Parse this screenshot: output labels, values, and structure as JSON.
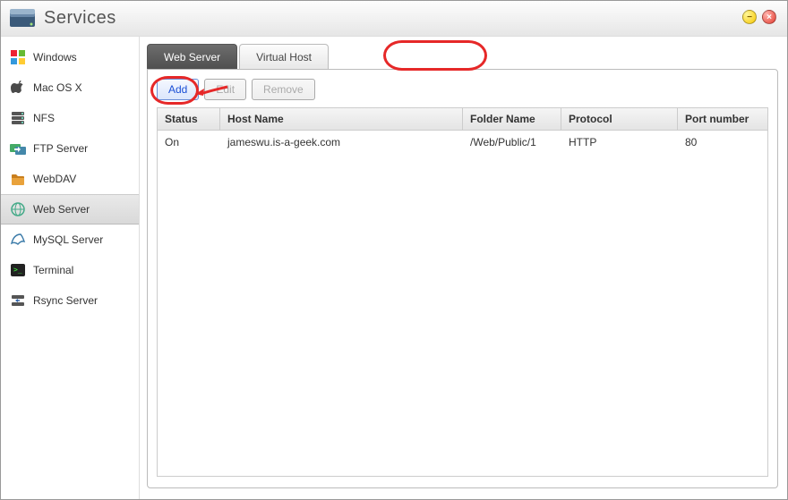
{
  "window": {
    "title": "Services"
  },
  "titlebar": {
    "minimize": "−",
    "close": "×"
  },
  "sidebar": {
    "items": [
      {
        "label": "Windows",
        "icon": "windows-icon"
      },
      {
        "label": "Mac OS X",
        "icon": "mac-icon"
      },
      {
        "label": "NFS",
        "icon": "nfs-icon"
      },
      {
        "label": "FTP Server",
        "icon": "ftp-icon"
      },
      {
        "label": "WebDAV",
        "icon": "webdav-icon"
      },
      {
        "label": "Web Server",
        "icon": "webserver-icon",
        "active": true
      },
      {
        "label": "MySQL Server",
        "icon": "mysql-icon"
      },
      {
        "label": "Terminal",
        "icon": "terminal-icon"
      },
      {
        "label": "Rsync Server",
        "icon": "rsync-icon"
      }
    ]
  },
  "tabs": [
    {
      "label": "Web Server",
      "active": true
    },
    {
      "label": "Virtual Host"
    }
  ],
  "toolbar": {
    "add_label": "Add",
    "edit_label": "Edit",
    "remove_label": "Remove"
  },
  "grid": {
    "headers": {
      "status": "Status",
      "host": "Host Name",
      "folder": "Folder Name",
      "protocol": "Protocol",
      "port": "Port number"
    },
    "rows": [
      {
        "status": "On",
        "host": "jameswu.is-a-geek.com",
        "folder": "/Web/Public/1",
        "protocol": "HTTP",
        "port": "80"
      }
    ]
  },
  "annotation": {
    "highlight_tab": "Virtual Host",
    "highlight_button": "Add",
    "color": "#e62828"
  }
}
